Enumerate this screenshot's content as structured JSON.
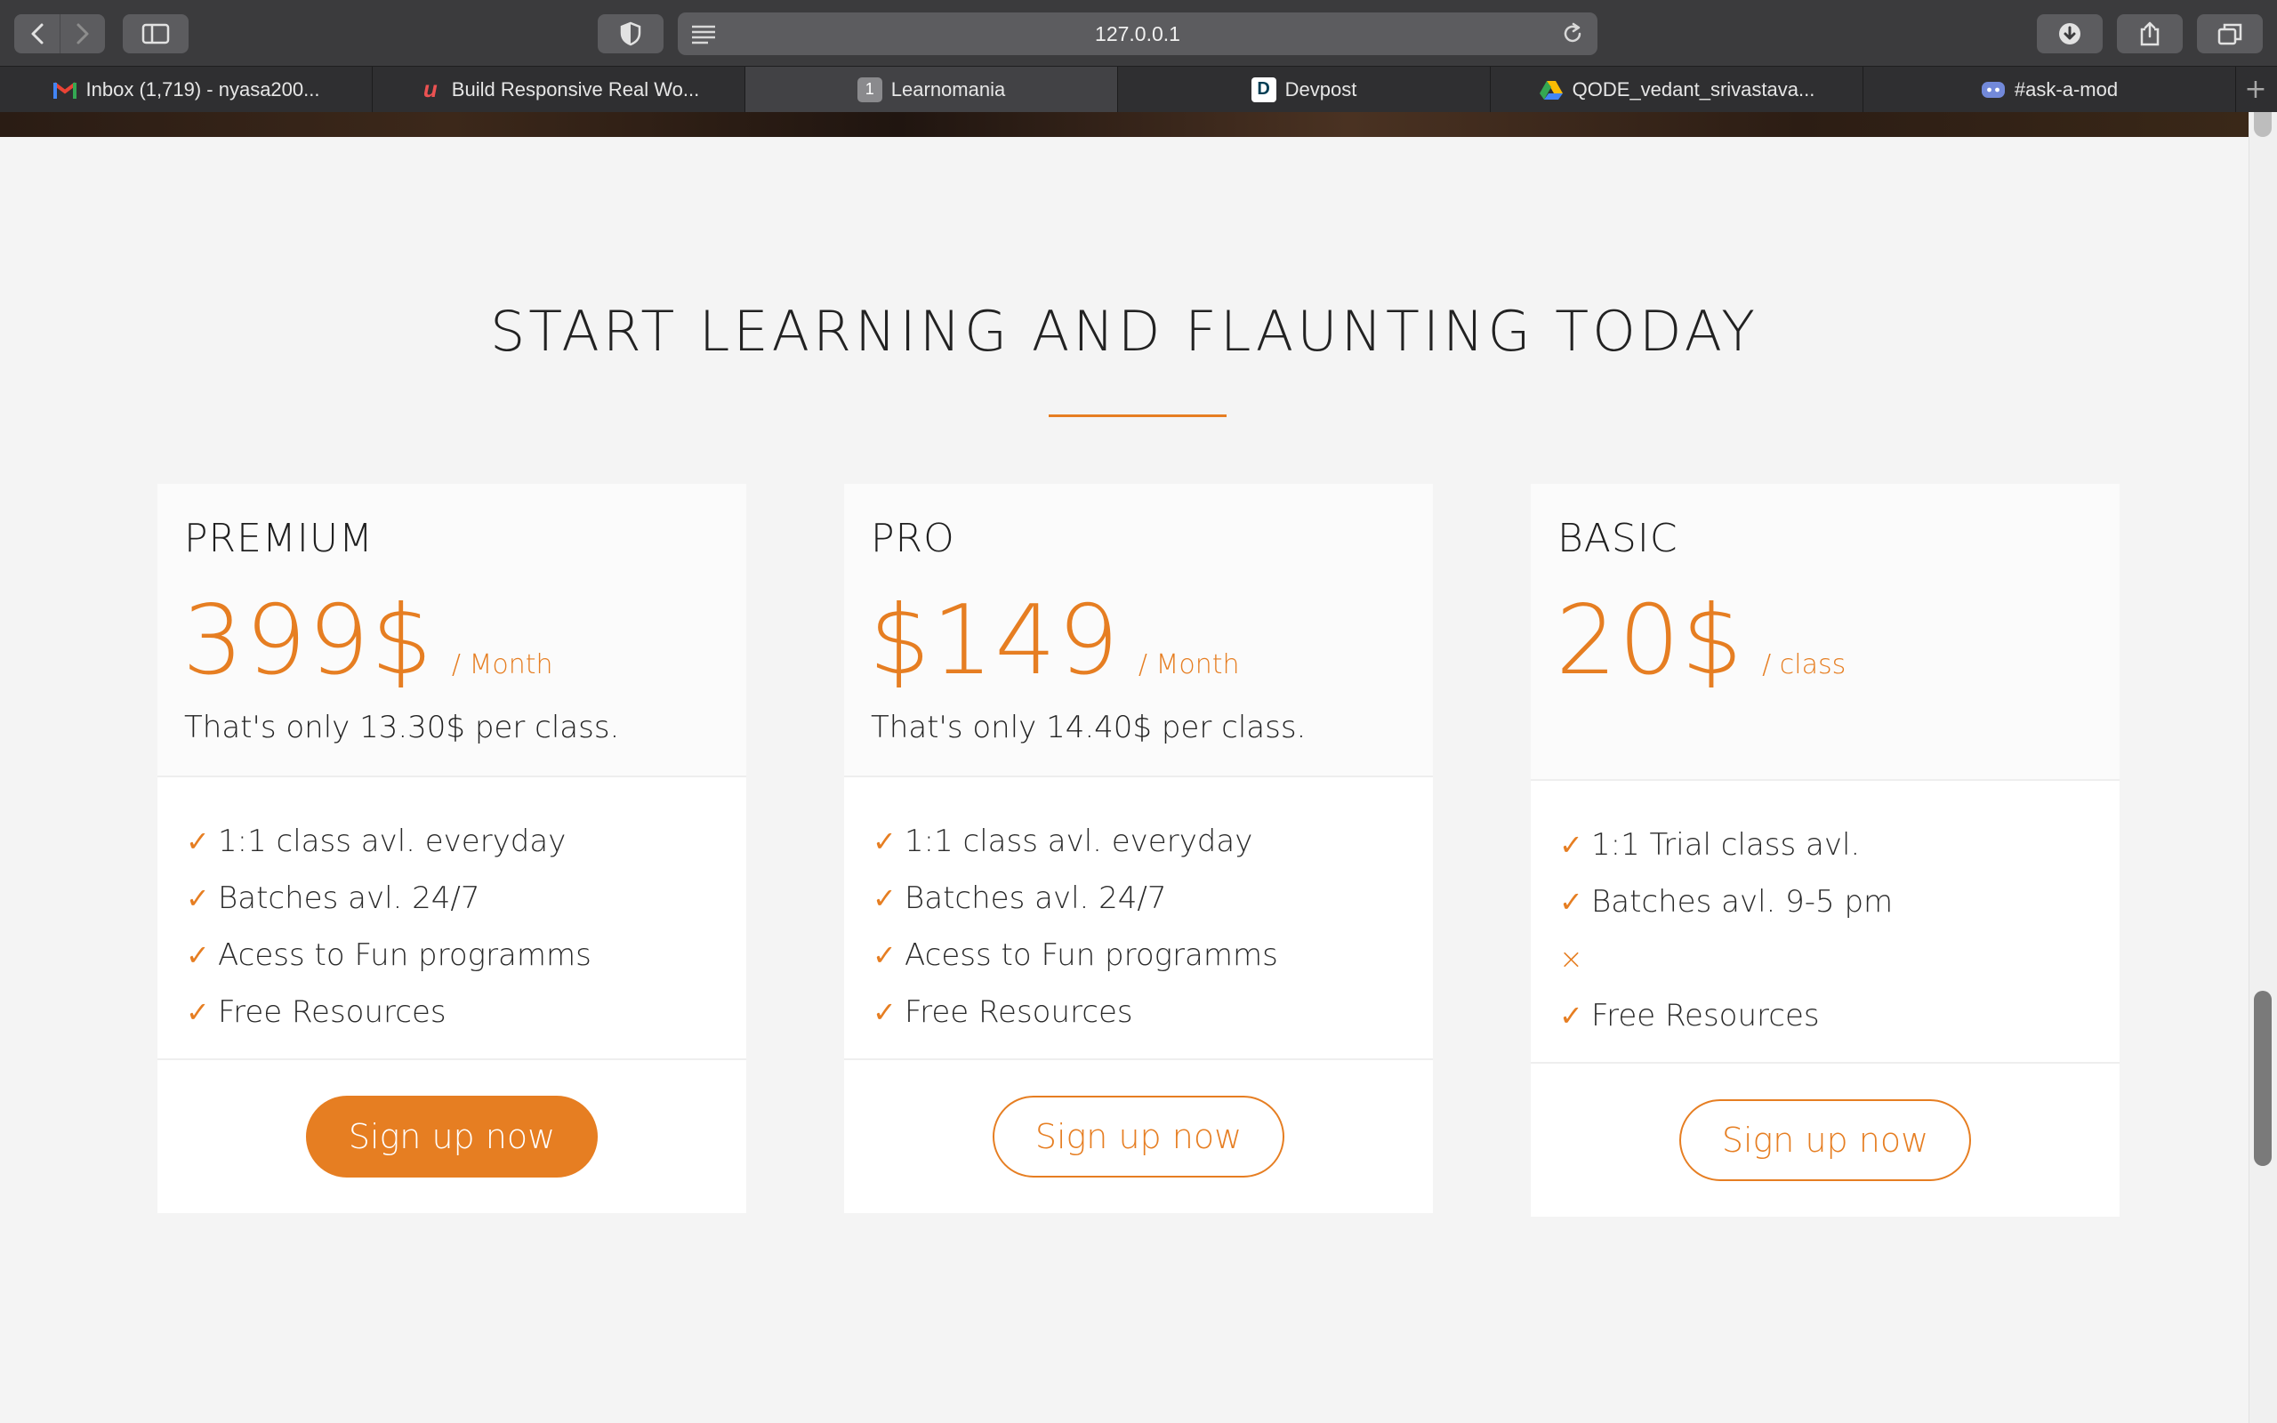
{
  "browser": {
    "url": "127.0.0.1",
    "tabs": [
      {
        "title": "Inbox (1,719) - nyasa200...",
        "icon": "gmail-icon"
      },
      {
        "title": "Build Responsive Real Wo...",
        "icon": "udemy-icon"
      },
      {
        "title": "Learnomania",
        "icon": "tab-number-icon",
        "badge": "1",
        "active": true
      },
      {
        "title": "Devpost",
        "icon": "devpost-icon",
        "badge": "D"
      },
      {
        "title": "QODE_vedant_srivastava...",
        "icon": "google-drive-icon"
      },
      {
        "title": "#ask-a-mod",
        "icon": "discord-icon"
      }
    ]
  },
  "section": {
    "title": "START LEARNING AND FLAUNTING TODAY"
  },
  "plans": [
    {
      "name": "PREMIUM",
      "price": "399$",
      "period": "/ Month",
      "note": "That's only 13.30$ per class.",
      "features": [
        {
          "mark": "✓",
          "text": "1:1 class avl. everyday"
        },
        {
          "mark": "✓",
          "text": "Batches avl. 24/7"
        },
        {
          "mark": "✓",
          "text": "Acess to Fun programms"
        },
        {
          "mark": "✓",
          "text": "Free Resources"
        }
      ],
      "cta": "Sign up now",
      "cta_style": "filled"
    },
    {
      "name": "PRO",
      "price": "$149",
      "period": "/ Month",
      "note": "That's only 14.40$ per class.",
      "features": [
        {
          "mark": "✓",
          "text": "1:1 class avl. everyday"
        },
        {
          "mark": "✓",
          "text": "Batches avl. 24/7"
        },
        {
          "mark": "✓",
          "text": "Acess to Fun programms"
        },
        {
          "mark": "✓",
          "text": "Free Resources"
        }
      ],
      "cta": "Sign up now",
      "cta_style": "outline"
    },
    {
      "name": "BASIC",
      "price": "20$",
      "period": "/ class",
      "note": "",
      "features": [
        {
          "mark": "✓",
          "text": "1:1 Trial class avl."
        },
        {
          "mark": "✓",
          "text": "Batches avl. 9-5 pm"
        },
        {
          "mark": "×",
          "text": ""
        },
        {
          "mark": "✓",
          "text": "Free Resources"
        }
      ],
      "cta": "Sign up now",
      "cta_style": "outline"
    }
  ],
  "colors": {
    "accent": "#e67e22",
    "page_bg": "#f4f4f4",
    "card_bg": "#ffffff"
  }
}
